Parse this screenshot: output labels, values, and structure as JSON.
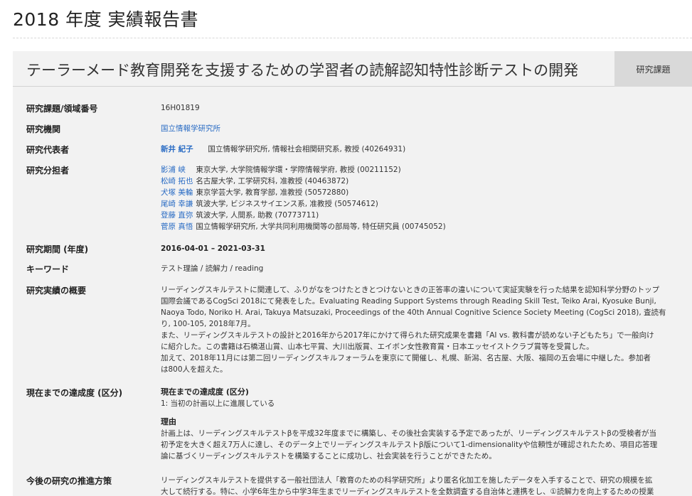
{
  "page": {
    "title": "2018 年度 実績報告書"
  },
  "header": {
    "project_title": "テーラーメード教育開発を支援するための学習者の読解認知特性診断テストの開発",
    "type_badge": "研究課題"
  },
  "fields": {
    "project_number": {
      "label": "研究課題/領域番号",
      "value": "16H01819"
    },
    "institution": {
      "label": "研究機関",
      "value": "国立情報学研究所"
    },
    "principal": {
      "label": "研究代表者",
      "name": "新井 紀子",
      "affiliation": "国立情報学研究所, 情報社会相関研究系, 教授 (40264931)"
    },
    "co_investigators": {
      "label": "研究分担者",
      "items": [
        {
          "name": "影浦 峡",
          "affiliation": "東京大学, 大学院情報学環・学際情報学府, 教授 (00211152)"
        },
        {
          "name": "松崎 拓也",
          "affiliation": "名古屋大学, 工学研究科, 准教授 (40463872)"
        },
        {
          "name": "犬塚 美輪",
          "affiliation": "東京学芸大学, 教育学部, 准教授 (50572880)"
        },
        {
          "name": "尾崎 幸謙",
          "affiliation": "筑波大学, ビジネスサイエンス系, 准教授 (50574612)"
        },
        {
          "name": "登藤 直弥",
          "affiliation": "筑波大学, 人間系, 助教 (70773711)"
        },
        {
          "name": "菅原 真悟",
          "affiliation": "国立情報学研究所, 大学共同利用機関等の部局等, 特任研究員 (00745052)"
        }
      ]
    },
    "period": {
      "label": "研究期間 (年度)",
      "value": "2016-04-01 – 2021-03-31"
    },
    "keywords": {
      "label": "キーワード",
      "value": "テスト理論 / 読解力 / reading"
    },
    "summary": {
      "label": "研究実績の概要",
      "lines": [
        "リーディングスキルテストに関連して、ふりがなをつけたときとつけないときの正答率の違いについて実証実験を行った結果を認知科学分野のトップ",
        "国際会議であるCogSci 2018にて発表をした。Evaluating Reading Support Systems through Reading Skill Test, Teiko Arai, Kyosuke Bunji,",
        "Naoya Todo, Noriko H. Arai, Takuya Matsuzaki, Proceedings of the 40th Annual Cognitive Science Society Meeting (CogSci 2018), 査読有",
        "り, 100-105, 2018年7月。",
        "また、リーディングスキルテストの設計と2016年から2017年にかけて得られた研究成果を書籍「AI vs. 教科書が読めない子どもたち」で一般向け",
        "に紹介した。この書籍は石橋湛山賞、山本七平賞、大川出版賞、エイボン女性教育賞・日本エッセイストクラブ賞等を受賞した。",
        "加えて、2018年11月には第二回リーディングスキルフォーラムを東京にて開催し、札幌、新潟、名古屋、大阪、福岡の五会場に中継した。参加者",
        "は800人を超えた。"
      ]
    },
    "progress": {
      "label": "現在までの達成度 (区分)",
      "sub_heading": "現在までの達成度 (区分)",
      "value": "1: 当初の計画以上に進展している",
      "reason_heading": "理由",
      "reason_lines": [
        "計画上は、リーディングスキルテストβを平成32年度までに構築し、その後社会実装する予定であったが、リーディングスキルテストβの受検者が当",
        "初予定を大きく超え7万人に達し、そのデータ上でリーディングスキルテストβ版について1-dimensionalityや信頼性が確認されたため、項目応答理",
        "論に基づくリーディングスキルテストを構築することに成功し、社会実装を行うことができたため。"
      ]
    },
    "future": {
      "label": "今後の研究の推進方策",
      "lines": [
        "リーディングスキルテストを提供する一般社団法人「教育のための科学研究所」より匿名化加工を施したデータを入手することで、研究の規模を拡",
        "大して続行する。特に、小学6年生から中学3年生までリーディングスキルテストを全数調査する自治体と連携をし、①読解力を向上するための授業"
      ]
    }
  }
}
